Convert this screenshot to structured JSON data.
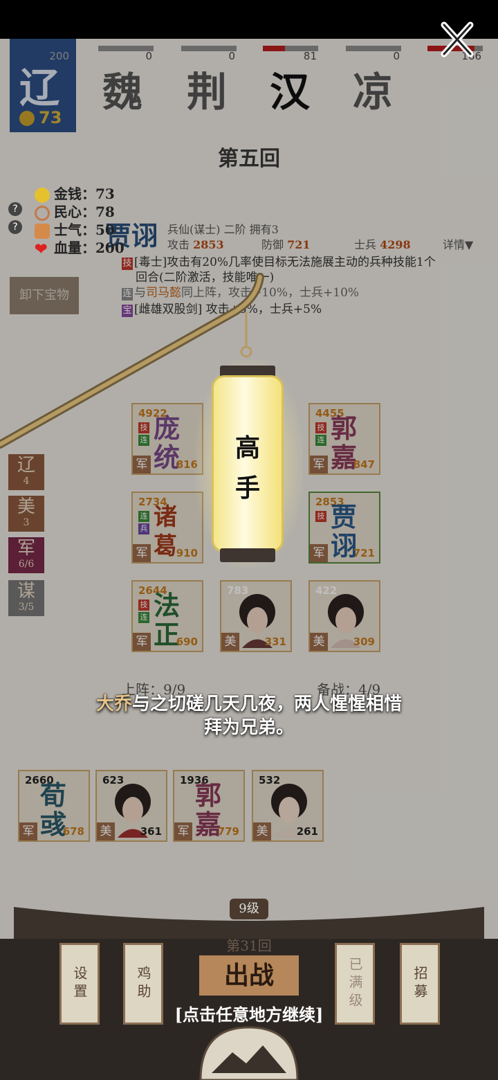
{
  "kingdoms": [
    {
      "name": "辽",
      "count": "200",
      "fill": 1.0
    },
    {
      "name": "魏",
      "count": "0",
      "fill": 0
    },
    {
      "name": "荆",
      "count": "0",
      "fill": 0
    },
    {
      "name": "汉",
      "count": "81",
      "fill": 0.4
    },
    {
      "name": "凉",
      "count": "0",
      "fill": 0
    },
    {
      "name": "",
      "count": "166",
      "fill": 0.85
    }
  ],
  "player_gold": "73",
  "round_title": "第五回",
  "stats": {
    "gold": "金钱：73",
    "morale_people": "民心：78",
    "morale_army": "士气：50",
    "hp": "血量：200",
    "help_mark": "?"
  },
  "hero": {
    "name": "贾诩",
    "subtitle": "兵仙(谋士)  二阶  拥有3",
    "attack_label": "攻击",
    "attack": "2853",
    "defense_label": "防御",
    "defense": "721",
    "soldiers_label": "士兵",
    "soldiers": "4298",
    "detail": "详情",
    "skill_tag": "技",
    "skill_line1": "[毒士]攻击有20%几率使目标无法施展主动的兵种技能1个",
    "skill_line2": "回合(二阶激活，技能唯一)",
    "link_tag": "连",
    "link_text_a": "与",
    "link_partner": "司马懿",
    "link_text_b": "同上阵，攻击+10%，士兵+10%",
    "treasure_tag": "宝",
    "treasure_text": "[雌雄双股剑] 攻击+5%，士兵+5%"
  },
  "unload_button": "卸下宝物",
  "side_tabs": [
    {
      "label": "辽",
      "sub": "4"
    },
    {
      "label": "美",
      "sub": "3"
    },
    {
      "label": "军",
      "sub": "6/6"
    },
    {
      "label": "谋",
      "sub": "3/5"
    }
  ],
  "cards": [
    {
      "name": "庞统",
      "power": "4922",
      "soldiers": "816",
      "type": "军",
      "color": "#7a4a8a"
    },
    {
      "name": "郭嘉",
      "power": "4455",
      "soldiers": "847",
      "type": "军",
      "color": "#8a3a5a"
    },
    {
      "name": "诸葛亮",
      "power": "2734",
      "soldiers": "910",
      "type": "军",
      "color": "#a33a1a"
    },
    {
      "name": "贾诩",
      "power": "2853",
      "soldiers": "721",
      "type": "军",
      "color": "#2a5a8a"
    },
    {
      "name": "法正",
      "power": "2644",
      "soldiers": "690",
      "type": "军",
      "color": "#2a6a3a"
    },
    {
      "name": "",
      "power": "783",
      "soldiers": "331",
      "type": "美",
      "color": "#333"
    },
    {
      "name": "",
      "power": "422",
      "soldiers": "309",
      "type": "美",
      "color": "#333"
    }
  ],
  "slot_on": "上阵：9/9",
  "slot_reserve": "备战：4/9",
  "reserve_cards": [
    {
      "name": "荀彧",
      "power": "2660",
      "soldiers": "678",
      "type": "军",
      "color": "#2a5a6a"
    },
    {
      "name": "",
      "power": "623",
      "soldiers": "361",
      "type": "美",
      "color": "#333"
    },
    {
      "name": "郭嘉",
      "power": "1936",
      "soldiers": "779",
      "type": "军",
      "color": "#8a3a5a"
    },
    {
      "name": "",
      "power": "532",
      "soldiers": "261",
      "type": "美",
      "color": "#333"
    }
  ],
  "lantern_text": "高手",
  "message": {
    "who": "大乔",
    "line1": "与之切磋几天几夜，两人惺惺相惜",
    "line2": "拜为兄弟。"
  },
  "level": "9级",
  "round_label": "第31回",
  "buttons": {
    "settings": "设置",
    "soup": "鸡助",
    "maxed": "已满级",
    "recruit": "招募",
    "fight": "出战"
  },
  "continue_hint": "[点击任意地方继续]",
  "colors": {
    "accent": "#b81d1d",
    "gold": "#d9b13a",
    "lantern": "#fffbe0"
  }
}
